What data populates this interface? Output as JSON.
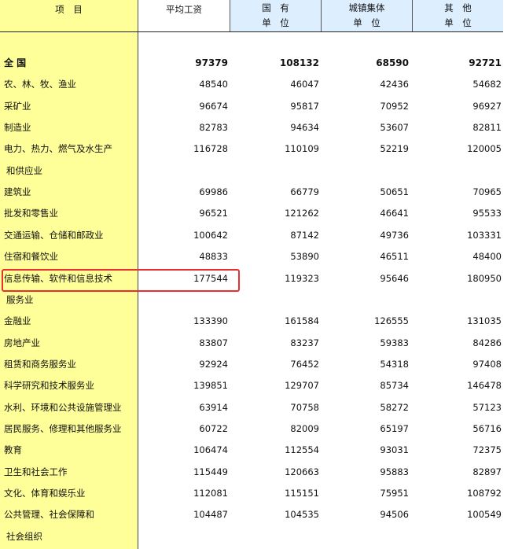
{
  "header": {
    "item": "项　目",
    "avg_wage": "平均工资",
    "state_owned": [
      "国　有",
      "单　位"
    ],
    "urban_collective": [
      "城镇集体",
      "单　位"
    ],
    "other": [
      "其　他",
      "单　位"
    ]
  },
  "rows": [
    {
      "label": "全 国",
      "values": [
        "97379",
        "108132",
        "68590",
        "92721"
      ],
      "bold": true
    },
    {
      "label": "农、林、牧、渔业",
      "values": [
        "48540",
        "46047",
        "42436",
        "54682"
      ]
    },
    {
      "label": "采矿业",
      "values": [
        "96674",
        "95817",
        "70952",
        "96927"
      ]
    },
    {
      "label": "制造业",
      "values": [
        "82783",
        "94634",
        "53607",
        "82811"
      ]
    },
    {
      "label": "电力、热力、燃气及水生产",
      "values": [
        "116728",
        "110109",
        "52219",
        "120005"
      ]
    },
    {
      "label": "和供应业",
      "values": [
        "",
        "",
        "",
        ""
      ],
      "indent": true
    },
    {
      "label": "建筑业",
      "values": [
        "69986",
        "66779",
        "50651",
        "70965"
      ]
    },
    {
      "label": "批发和零售业",
      "values": [
        "96521",
        "121262",
        "46641",
        "95533"
      ]
    },
    {
      "label": "交通运输、仓储和邮政业",
      "values": [
        "100642",
        "87142",
        "49736",
        "103331"
      ]
    },
    {
      "label": "住宿和餐饮业",
      "values": [
        "48833",
        "53890",
        "46511",
        "48400"
      ]
    },
    {
      "label": "信息传输、软件和信息技术",
      "values": [
        "177544",
        "119323",
        "95646",
        "180950"
      ]
    },
    {
      "label": "服务业",
      "values": [
        "",
        "",
        "",
        ""
      ],
      "indent": true
    },
    {
      "label": "金融业",
      "values": [
        "133390",
        "161584",
        "126555",
        "131035"
      ]
    },
    {
      "label": "房地产业",
      "values": [
        "83807",
        "83237",
        "59383",
        "84286"
      ]
    },
    {
      "label": "租赁和商务服务业",
      "values": [
        "92924",
        "76452",
        "54318",
        "97408"
      ]
    },
    {
      "label": "科学研究和技术服务业",
      "values": [
        "139851",
        "129707",
        "85734",
        "146478"
      ]
    },
    {
      "label": "水利、环境和公共设施管理业",
      "values": [
        "63914",
        "70758",
        "58272",
        "57123"
      ]
    },
    {
      "label": "居民服务、修理和其他服务业",
      "values": [
        "60722",
        "82009",
        "65197",
        "56716"
      ]
    },
    {
      "label": "教育",
      "values": [
        "106474",
        "112554",
        "93031",
        "72375"
      ]
    },
    {
      "label": "卫生和社会工作",
      "values": [
        "115449",
        "120663",
        "95883",
        "82897"
      ]
    },
    {
      "label": "文化、体育和娱乐业",
      "values": [
        "112081",
        "115151",
        "75951",
        "108792"
      ]
    },
    {
      "label": "公共管理、社会保障和",
      "values": [
        "104487",
        "104535",
        "94506",
        "100549"
      ]
    },
    {
      "label": "社会组织",
      "values": [
        "",
        "",
        "",
        ""
      ],
      "indent": true
    }
  ],
  "highlight": {
    "color": "#e83030",
    "row_label": "信息传输、软件和信息技术"
  }
}
